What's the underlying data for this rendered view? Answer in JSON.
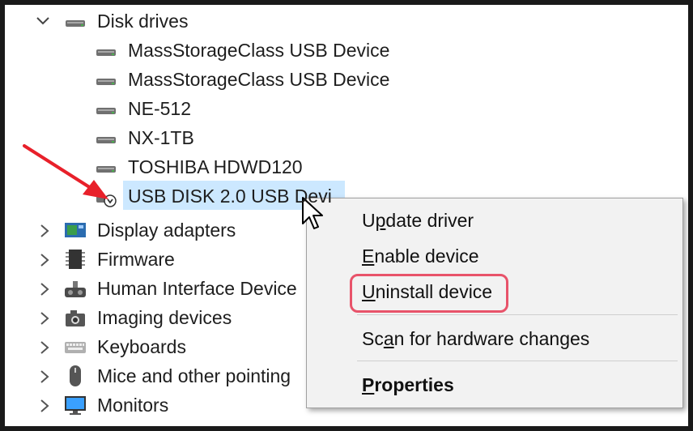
{
  "tree": {
    "disk_drives": {
      "label": "Disk drives",
      "children": [
        "MassStorageClass USB Device",
        "MassStorageClass USB Device",
        "NE-512",
        "NX-1TB",
        "TOSHIBA HDWD120",
        "USB DISK 2.0 USB Devi"
      ]
    },
    "categories": [
      {
        "label": "Display adapters",
        "icon": "display-adapter-icon"
      },
      {
        "label": "Firmware",
        "icon": "firmware-chip-icon"
      },
      {
        "label": "Human Interface Device",
        "icon": "human-interface-device-icon"
      },
      {
        "label": "Imaging devices",
        "icon": "camera-icon"
      },
      {
        "label": "Keyboards",
        "icon": "keyboard-icon"
      },
      {
        "label": "Mice and other pointing",
        "icon": "mouse-icon"
      },
      {
        "label": "Monitors",
        "icon": "monitor-icon"
      }
    ]
  },
  "context_menu": {
    "items": [
      {
        "pre": "U",
        "u": "p",
        "post": "date driver"
      },
      {
        "pre": "",
        "u": "E",
        "post": "nable device"
      },
      {
        "pre": "",
        "u": "U",
        "post": "ninstall device"
      },
      {
        "pre": "Sc",
        "u": "a",
        "post": "n for hardware changes"
      },
      {
        "pre": "",
        "u": "P",
        "post": "roperties"
      }
    ]
  },
  "colors": {
    "selection": "#cce8ff",
    "highlight_box": "#e8536a",
    "arrow": "#e8202a"
  }
}
